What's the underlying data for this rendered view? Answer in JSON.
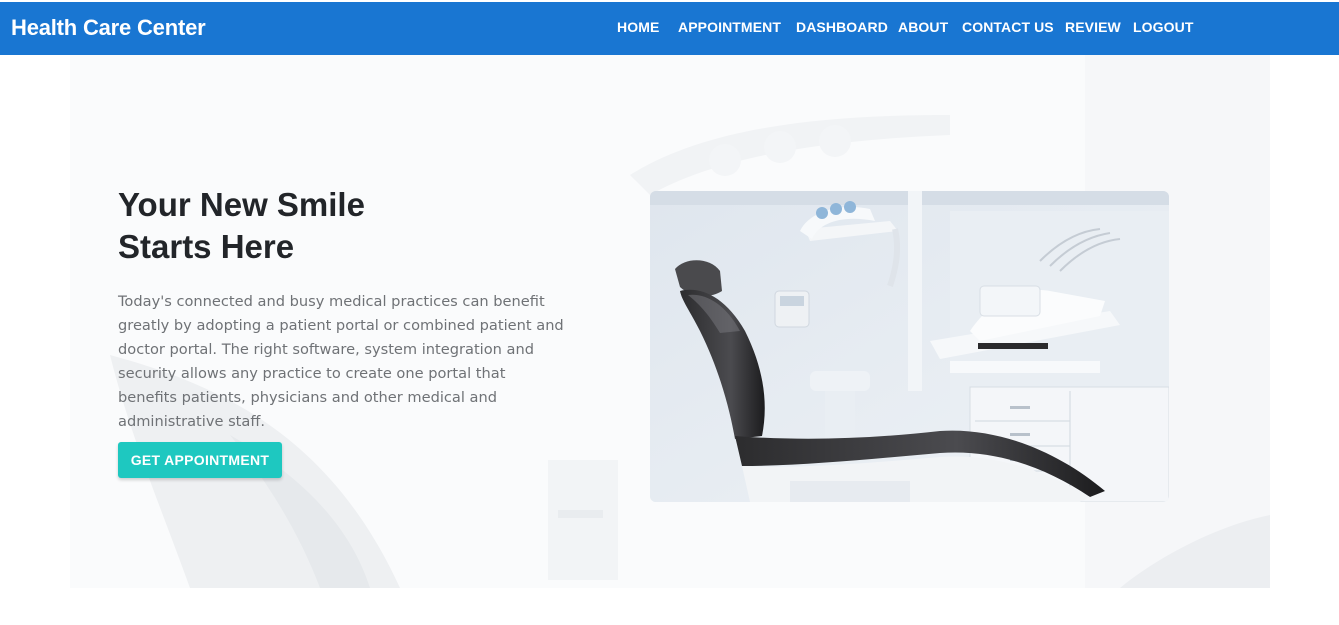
{
  "header": {
    "brand": "Health Care Center",
    "nav": [
      {
        "key": "home",
        "label": "HOME"
      },
      {
        "key": "appointment",
        "label": "APPOINTMENT"
      },
      {
        "key": "dashboard",
        "label": "DASHBOARD"
      },
      {
        "key": "about",
        "label": "ABOUT"
      },
      {
        "key": "contact",
        "label": "CONTACT US"
      },
      {
        "key": "review",
        "label": "REVIEW"
      },
      {
        "key": "logout",
        "label": "LOGOUT"
      }
    ]
  },
  "hero": {
    "title_line1": "Your New Smile",
    "title_line2": "Starts Here",
    "description": "Today's connected and busy medical practices can benefit greatly by adopting a patient portal or combined patient and doctor portal. The right software, system integration and security allows any practice to create one portal that benefits patients, physicians and other medical and administrative staff.",
    "cta_label": "GET APPOINTMENT",
    "image_subject": "dental-chair-photo"
  },
  "colors": {
    "header_bg": "#1976d2",
    "cta_bg": "#1ec8c0",
    "title_text": "#222529",
    "body_text": "#6f7276"
  }
}
